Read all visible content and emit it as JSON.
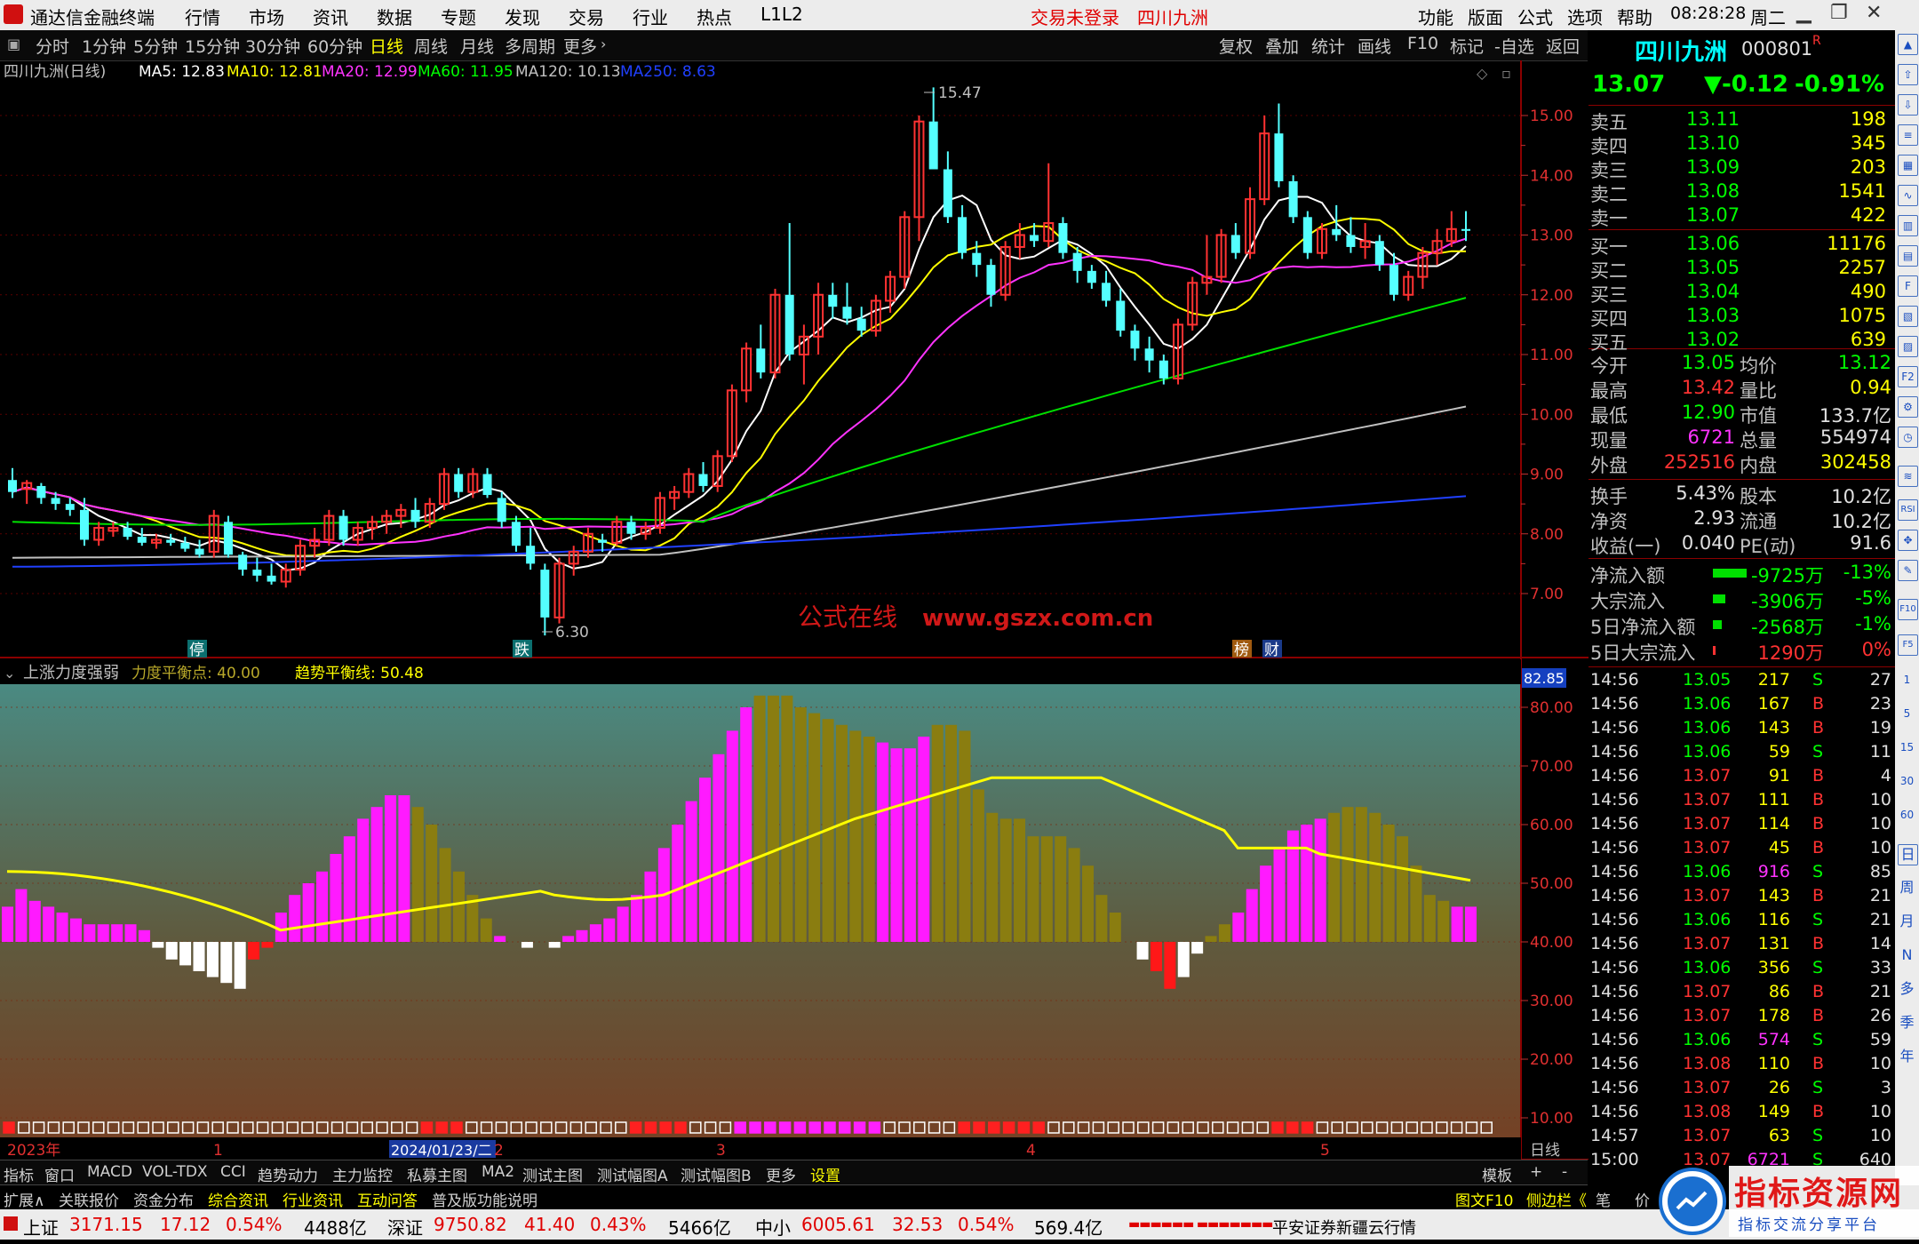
{
  "menu": {
    "app_title": "通达信金融终端",
    "items": [
      "行情",
      "市场",
      "资讯",
      "数据",
      "专题",
      "发现",
      "交易",
      "行业",
      "热点",
      "L1L2"
    ],
    "trade_status": "交易未登录",
    "stock_name": "四川九洲",
    "right_items": [
      "功能",
      "版面",
      "公式",
      "选项",
      "帮助"
    ],
    "time": "08:28:28",
    "weekday": "周二"
  },
  "periods": {
    "items": [
      "分时",
      "1分钟",
      "5分钟",
      "15分钟",
      "30分钟",
      "60分钟",
      "日线",
      "周线",
      "月线",
      "多周期",
      "更多"
    ],
    "active": "日线",
    "right_items": [
      "复权",
      "叠加",
      "统计",
      "画线",
      "F10",
      "标记",
      "-自选",
      "返回"
    ]
  },
  "chart_info": {
    "title": "四川九洲(日线)",
    "ma5": "MA5: 12.83",
    "ma10": "MA10: 12.81",
    "ma20": "MA20: 12.99",
    "ma60": "MA60: 11.95",
    "ma120": "MA120: 10.13",
    "ma250": "MA250: 8.63",
    "high_label": "15.47",
    "low_label": "6.30",
    "watermark": "公式在线",
    "watermark_url": "www.gszx.com.cn",
    "markers": [
      "停",
      "跌",
      "榜",
      "财"
    ]
  },
  "price_axis": [
    "15.00",
    "14.00",
    "13.00",
    "12.00",
    "11.00",
    "10.00",
    "9.00",
    "8.00",
    "7.00"
  ],
  "indicator": {
    "name": "上涨力度强弱",
    "balance_point": "力度平衡点: 40.00",
    "trend_line": "趋势平衡线: 50.48",
    "current": "82.85",
    "axis": [
      "80.00",
      "70.00",
      "60.00",
      "50.00",
      "40.00",
      "30.00",
      "20.00",
      "10.00"
    ]
  },
  "date_axis": {
    "year": "2023年",
    "ticks": [
      "1",
      "2024/01/23/二",
      "2",
      "3",
      "4",
      "5"
    ],
    "period": "日线"
  },
  "quote": {
    "name": "四川九洲",
    "code": "000801",
    "flag": "R",
    "price": "13.07",
    "change": "▼-0.12",
    "pct": "-0.91%",
    "asks": [
      {
        "label": "卖五",
        "price": "13.11",
        "vol": "198"
      },
      {
        "label": "卖四",
        "price": "13.10",
        "vol": "345"
      },
      {
        "label": "卖三",
        "price": "13.09",
        "vol": "203"
      },
      {
        "label": "卖二",
        "price": "13.08",
        "vol": "1541"
      },
      {
        "label": "卖一",
        "price": "13.07",
        "vol": "422"
      }
    ],
    "bids": [
      {
        "label": "买一",
        "price": "13.06",
        "vol": "11176"
      },
      {
        "label": "买二",
        "price": "13.05",
        "vol": "2257"
      },
      {
        "label": "买三",
        "price": "13.04",
        "vol": "490"
      },
      {
        "label": "买四",
        "price": "13.03",
        "vol": "1075"
      },
      {
        "label": "买五",
        "price": "13.02",
        "vol": "639"
      }
    ],
    "stats1": [
      {
        "l1": "今开",
        "v1": "13.05",
        "l2": "均价",
        "v2": "13.12"
      },
      {
        "l1": "最高",
        "v1": "13.42",
        "l2": "量比",
        "v2": "0.94"
      },
      {
        "l1": "最低",
        "v1": "12.90",
        "l2": "市值",
        "v2": "133.7亿"
      },
      {
        "l1": "现量",
        "v1": "6721",
        "l2": "总量",
        "v2": "554974"
      },
      {
        "l1": "外盘",
        "v1": "252516",
        "l2": "内盘",
        "v2": "302458"
      }
    ],
    "stats2": [
      {
        "l1": "换手",
        "v1": "5.43%",
        "l2": "股本",
        "v2": "10.2亿"
      },
      {
        "l1": "净资",
        "v1": "2.93",
        "l2": "流通",
        "v2": "10.2亿"
      },
      {
        "l1": "收益(一)",
        "v1": "0.040",
        "l2": "PE(动)",
        "v2": "91.6"
      }
    ],
    "flows": [
      {
        "label": "净流入额",
        "value": "-9725万",
        "pct": "-13%"
      },
      {
        "label": "大宗流入",
        "value": "-3906万",
        "pct": "-5%"
      },
      {
        "label": "5日净流入额",
        "value": "-2568万",
        "pct": "-1%"
      },
      {
        "label": "5日大宗流入",
        "value": "1290万",
        "pct": "0%"
      }
    ],
    "ticks": [
      {
        "t": "14:56",
        "p": "13.05",
        "v": "217",
        "s": "S",
        "n": "27"
      },
      {
        "t": "14:56",
        "p": "13.06",
        "v": "167",
        "s": "B",
        "n": "23"
      },
      {
        "t": "14:56",
        "p": "13.06",
        "v": "143",
        "s": "B",
        "n": "19"
      },
      {
        "t": "14:56",
        "p": "13.06",
        "v": "59",
        "s": "S",
        "n": "11"
      },
      {
        "t": "14:56",
        "p": "13.07",
        "v": "91",
        "s": "B",
        "n": "4"
      },
      {
        "t": "14:56",
        "p": "13.07",
        "v": "111",
        "s": "B",
        "n": "10"
      },
      {
        "t": "14:56",
        "p": "13.07",
        "v": "114",
        "s": "B",
        "n": "10"
      },
      {
        "t": "14:56",
        "p": "13.07",
        "v": "45",
        "s": "B",
        "n": "10"
      },
      {
        "t": "14:56",
        "p": "13.06",
        "v": "916",
        "s": "S",
        "n": "85"
      },
      {
        "t": "14:56",
        "p": "13.07",
        "v": "143",
        "s": "B",
        "n": "21"
      },
      {
        "t": "14:56",
        "p": "13.06",
        "v": "116",
        "s": "S",
        "n": "21"
      },
      {
        "t": "14:56",
        "p": "13.07",
        "v": "131",
        "s": "B",
        "n": "14"
      },
      {
        "t": "14:56",
        "p": "13.06",
        "v": "356",
        "s": "S",
        "n": "33"
      },
      {
        "t": "14:56",
        "p": "13.07",
        "v": "86",
        "s": "B",
        "n": "21"
      },
      {
        "t": "14:56",
        "p": "13.07",
        "v": "178",
        "s": "B",
        "n": "26"
      },
      {
        "t": "14:56",
        "p": "13.06",
        "v": "574",
        "s": "S",
        "n": "59"
      },
      {
        "t": "14:56",
        "p": "13.08",
        "v": "110",
        "s": "B",
        "n": "10"
      },
      {
        "t": "14:56",
        "p": "13.07",
        "v": "26",
        "s": "S",
        "n": "3"
      },
      {
        "t": "14:56",
        "p": "13.08",
        "v": "149",
        "s": "B",
        "n": "10"
      },
      {
        "t": "14:57",
        "p": "13.07",
        "v": "63",
        "s": "S",
        "n": "10"
      },
      {
        "t": "15:00",
        "p": "13.07",
        "v": "6721",
        "s": "S",
        "n": "640"
      }
    ]
  },
  "bottom_tabs1": [
    "指标",
    "窗口",
    "MACD",
    "VOL-TDX",
    "CCI",
    "趋势动力",
    "主力监控",
    "私募主图",
    "MA2",
    "测试主图",
    "测试幅图A",
    "测试幅图B",
    "更多",
    "设置"
  ],
  "bottom_right1": [
    "模板",
    "+",
    "-"
  ],
  "bottom_tabs2": [
    "扩展∧",
    "关联报价",
    "资金分布",
    "综合资讯",
    "行业资讯",
    "互动问答",
    "普及版功能说明"
  ],
  "bottom_right2": [
    "图文F10",
    "侧边栏《",
    "笔",
    "价"
  ],
  "status": {
    "sh_label": "上证",
    "sh_value": "3171.15",
    "sh_change": "17.12",
    "sh_pct": "0.54%",
    "sh_amount": "4488亿",
    "sz_label": "深证",
    "sz_value": "9750.82",
    "sz_change": "41.40",
    "sz_pct": "0.43%",
    "sz_amount": "5466亿",
    "zx_label": "中小",
    "zx_value": "6005.61",
    "zx_change": "32.53",
    "zx_pct": "0.54%",
    "zx_amount": "569.4亿",
    "broker": "平安证券新疆云行情"
  },
  "brand": {
    "title": "指标资源网",
    "subtitle": "指标交流分享平台"
  },
  "right_toolbar": [
    "RSI",
    "F10",
    "F5",
    "1",
    "5",
    "15",
    "30",
    "60",
    "日",
    "周",
    "月",
    "N",
    "多",
    "季",
    "年"
  ]
}
